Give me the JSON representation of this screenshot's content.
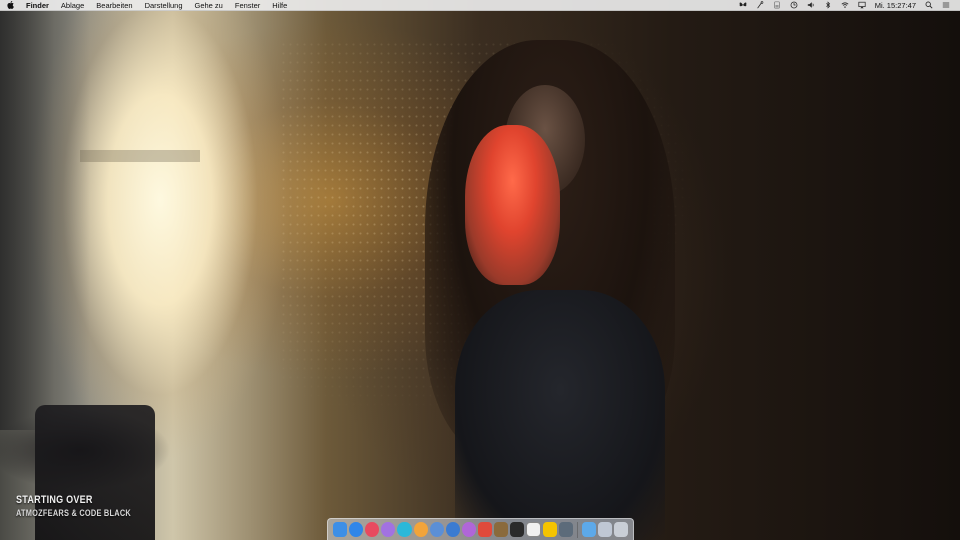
{
  "menubar": {
    "app_name": "Finder",
    "items": [
      "Ablage",
      "Bearbeiten",
      "Darstellung",
      "Gehe zu",
      "Fenster",
      "Hilfe"
    ],
    "clock": "Mi. 15:27:47",
    "status_icons": [
      "butterfly-icon",
      "wand-icon",
      "battery-icon",
      "time-machine-icon",
      "volume-icon",
      "bluetooth-icon",
      "wifi-icon",
      "airplay-icon",
      "clock-text",
      "spotlight-icon",
      "notification-center-icon"
    ]
  },
  "now_playing": {
    "title": "Starting Over",
    "artist": "Atmozfears & Code Black"
  },
  "dock": {
    "apps": [
      {
        "name": "finder-icon",
        "color": "#3d8fe6"
      },
      {
        "name": "safari-icon",
        "color": "#2f86e9"
      },
      {
        "name": "itunes-icon",
        "color": "#e84a5f"
      },
      {
        "name": "purple-app-icon",
        "color": "#a272e0"
      },
      {
        "name": "teal-app-icon",
        "color": "#2bb8d9"
      },
      {
        "name": "orange-app-icon",
        "color": "#f2a43a"
      },
      {
        "name": "blue-app-icon",
        "color": "#5b8fd6"
      },
      {
        "name": "music-app-icon",
        "color": "#3b7bd1"
      },
      {
        "name": "podcast-app-icon",
        "color": "#b066d8"
      },
      {
        "name": "red-app-icon",
        "color": "#e04a3b"
      },
      {
        "name": "notes-app-icon",
        "color": "#8a6a3c"
      },
      {
        "name": "script-app-icon",
        "color": "#2a2a2a"
      },
      {
        "name": "chess-app-icon",
        "color": "#f0f0f0"
      },
      {
        "name": "cyberduck-icon",
        "color": "#f5c400"
      },
      {
        "name": "utility-app-icon",
        "color": "#5c6b7a"
      }
    ],
    "right": [
      {
        "name": "downloads-folder-icon",
        "color": "#5da9e9"
      },
      {
        "name": "documents-icon",
        "color": "#bfc7d4"
      },
      {
        "name": "trash-icon",
        "color": "#c9ced6"
      }
    ]
  }
}
